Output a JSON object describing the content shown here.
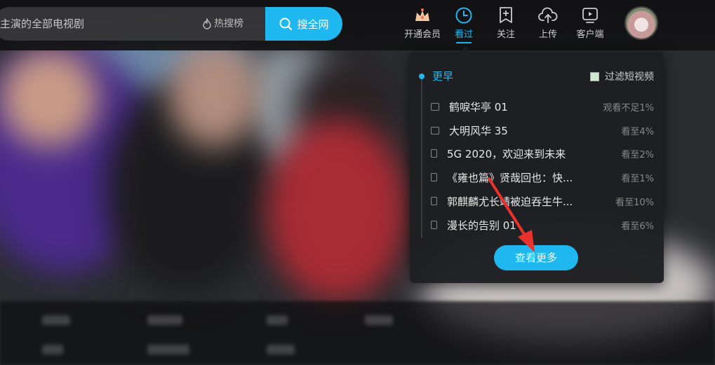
{
  "header": {
    "search": {
      "value": "主演的全部电视剧",
      "hot_label": "热搜榜",
      "button_label": "搜全网"
    },
    "nav": [
      {
        "label": "开通会员",
        "icon": "crown-icon"
      },
      {
        "label": "看过",
        "icon": "clock-icon",
        "active": true
      },
      {
        "label": "关注",
        "icon": "bookmark-plus-icon"
      },
      {
        "label": "上传",
        "icon": "cloud-upload-icon"
      },
      {
        "label": "客户端",
        "icon": "tv-play-icon"
      }
    ]
  },
  "history_panel": {
    "group_title": "更早",
    "filter_label": "过滤短视频",
    "items": [
      {
        "title": "鹤唳华亭 01",
        "progress": "观看不足1%",
        "device": "pc"
      },
      {
        "title": "大明风华 35",
        "progress": "看至4%",
        "device": "pc"
      },
      {
        "title": "5G 2020，欢迎来到未来",
        "progress": "看至2%",
        "device": "phone"
      },
      {
        "title": "《雍也篇》贤哉回也：快...",
        "progress": "看至1%",
        "device": "phone"
      },
      {
        "title": "郭麒麟尤长靖被迫吞生牛...",
        "progress": "看至10%",
        "device": "phone"
      },
      {
        "title": "漫长的告别 01",
        "progress": "看至6%",
        "device": "phone"
      }
    ],
    "more_label": "查看更多"
  },
  "colors": {
    "accent": "#1fb8f0",
    "panel_bg": "#1e1f22",
    "annotation_arrow": "#e8322b"
  }
}
